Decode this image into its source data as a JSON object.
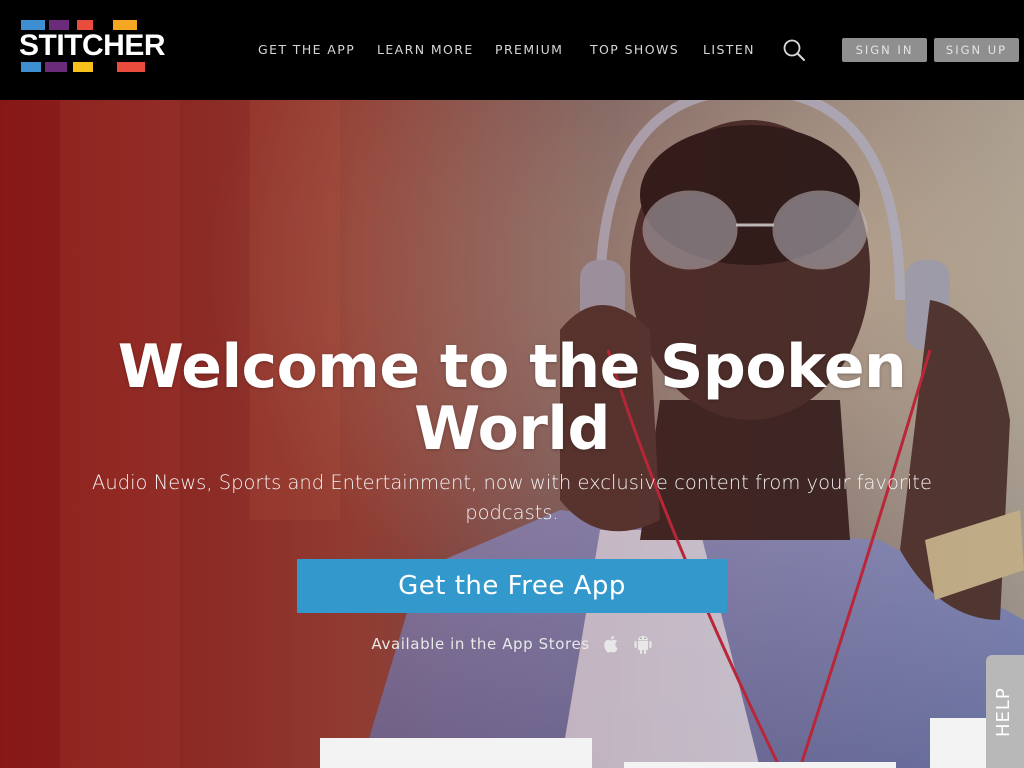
{
  "brand": {
    "name": "STITCHER",
    "colors": {
      "top_bars": [
        "#3d8fd1",
        "#6a2b7a",
        "#e94c3d",
        "#f5a623"
      ],
      "bottom_bars": [
        "#3d8fd1",
        "#6a2b7a",
        "#f5c11a",
        "#e94c3d"
      ]
    }
  },
  "nav": {
    "items": [
      "GET THE APP",
      "LEARN MORE",
      "PREMIUM",
      "TOP SHOWS",
      "LISTEN"
    ],
    "search_icon": "search-icon",
    "sign_in": "SIGN IN",
    "sign_up": "SIGN UP"
  },
  "hero": {
    "headline": "Welcome to the Spoken World",
    "subhead": "Audio News, Sports and Entertainment, now with exclusive content from your favorite podcasts.",
    "cta_label": "Get the Free App",
    "cta_color": "#3399cc",
    "stores_text": "Available in the App Stores",
    "store_icons": [
      "apple-icon",
      "android-icon"
    ]
  },
  "help": {
    "label": "HELP"
  }
}
